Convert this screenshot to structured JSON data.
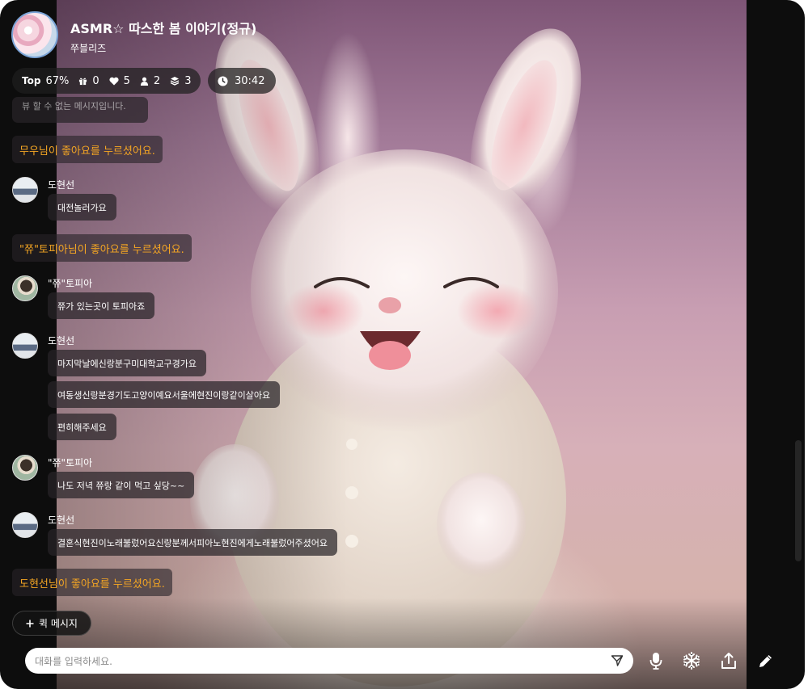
{
  "header": {
    "title": "ASMR☆ 따스한 봄 이야기(정규)",
    "host": "쭈블리즈"
  },
  "stats": {
    "top_label": "Top",
    "top_percent": "67%",
    "gifts": "0",
    "likes": "5",
    "viewers": "2",
    "layers": "3",
    "timer": "30:42"
  },
  "chat": {
    "partial_text": "뷰 할 수 없는 메시지입니다.",
    "sys1": "무우님이 좋아요를 누르셨어요.",
    "user1": {
      "name": "도현선",
      "msg1": "대전놀러가요"
    },
    "sys2": "\"쮸\"토피아님이 좋아요를 누르셨어요.",
    "user2": {
      "name": "\"쮸\"토피아",
      "msg1": "쮸가 있는곳이 토피아죠"
    },
    "user3": {
      "name": "도현선",
      "msg1": "마지막날에신랑분구미대학교구경가요",
      "msg2": "여동생신랑분경기도고양이예요서울에현진이랑같이살아요",
      "msg3": "편히해주세요"
    },
    "user4": {
      "name": "\"쮸\"토피아",
      "msg1": "나도 저녁 쮸랑 같이 먹고 싶당~~"
    },
    "user5": {
      "name": "도현선",
      "msg1": "결혼식현진이노래불렀어요신랑분께서피아노현진에게노래불렀어주셨어요"
    },
    "sys3": "도현선님이 좋아요를 누르셨어요."
  },
  "quick_message": "퀵 메시지",
  "input": {
    "placeholder": "대화를 입력하세요."
  },
  "colors": {
    "system_text": "#f5a623",
    "bubble_bg": "#2a2428",
    "input_bg": "#ffffff"
  }
}
